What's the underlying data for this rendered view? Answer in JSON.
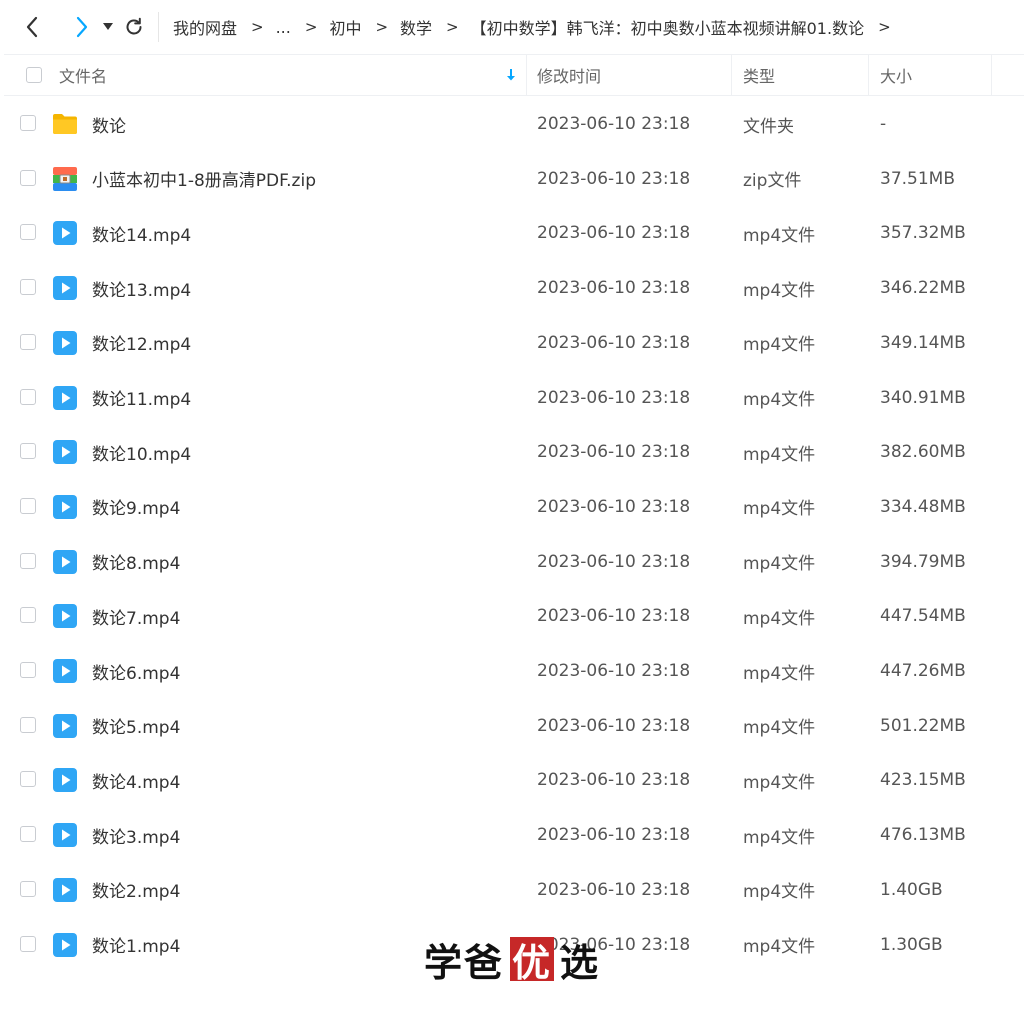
{
  "toolbar": {
    "back_icon": "chevron-left-icon",
    "forward_icon": "chevron-right-icon",
    "dropdown_icon": "caret-down-icon",
    "refresh_icon": "refresh-icon",
    "forward_color": "#06a7ff"
  },
  "breadcrumb": {
    "items": [
      "我的网盘",
      "...",
      "初中",
      "数学",
      "【初中数学】韩飞洋：初中奥数小蓝本视频讲解01.数论"
    ],
    "separator": ">"
  },
  "table": {
    "headers": {
      "name": "文件名",
      "modified": "修改时间",
      "type": "类型",
      "size": "大小"
    },
    "sort_icon": "sort-down-arrow-icon",
    "sort_color": "#06a7ff",
    "rows": [
      {
        "name": "数论",
        "modified": "2023-06-10 23:18",
        "type": "文件夹",
        "size": "-",
        "icon": "folder-icon"
      },
      {
        "name": "小蓝本初中1-8册高清PDF.zip",
        "modified": "2023-06-10 23:18",
        "type": "zip文件",
        "size": "37.51MB",
        "icon": "zip-icon"
      },
      {
        "name": "数论14.mp4",
        "modified": "2023-06-10 23:18",
        "type": "mp4文件",
        "size": "357.32MB",
        "icon": "video-icon"
      },
      {
        "name": "数论13.mp4",
        "modified": "2023-06-10 23:18",
        "type": "mp4文件",
        "size": "346.22MB",
        "icon": "video-icon"
      },
      {
        "name": "数论12.mp4",
        "modified": "2023-06-10 23:18",
        "type": "mp4文件",
        "size": "349.14MB",
        "icon": "video-icon"
      },
      {
        "name": "数论11.mp4",
        "modified": "2023-06-10 23:18",
        "type": "mp4文件",
        "size": "340.91MB",
        "icon": "video-icon"
      },
      {
        "name": "数论10.mp4",
        "modified": "2023-06-10 23:18",
        "type": "mp4文件",
        "size": "382.60MB",
        "icon": "video-icon"
      },
      {
        "name": "数论9.mp4",
        "modified": "2023-06-10 23:18",
        "type": "mp4文件",
        "size": "334.48MB",
        "icon": "video-icon"
      },
      {
        "name": "数论8.mp4",
        "modified": "2023-06-10 23:18",
        "type": "mp4文件",
        "size": "394.79MB",
        "icon": "video-icon"
      },
      {
        "name": "数论7.mp4",
        "modified": "2023-06-10 23:18",
        "type": "mp4文件",
        "size": "447.54MB",
        "icon": "video-icon"
      },
      {
        "name": "数论6.mp4",
        "modified": "2023-06-10 23:18",
        "type": "mp4文件",
        "size": "447.26MB",
        "icon": "video-icon"
      },
      {
        "name": "数论5.mp4",
        "modified": "2023-06-10 23:18",
        "type": "mp4文件",
        "size": "501.22MB",
        "icon": "video-icon"
      },
      {
        "name": "数论4.mp4",
        "modified": "2023-06-10 23:18",
        "type": "mp4文件",
        "size": "423.15MB",
        "icon": "video-icon"
      },
      {
        "name": "数论3.mp4",
        "modified": "2023-06-10 23:18",
        "type": "mp4文件",
        "size": "476.13MB",
        "icon": "video-icon"
      },
      {
        "name": "数论2.mp4",
        "modified": "2023-06-10 23:18",
        "type": "mp4文件",
        "size": "1.40GB",
        "icon": "video-icon"
      },
      {
        "name": "数论1.mp4",
        "modified": "2023-06-10 23:18",
        "type": "mp4文件",
        "size": "1.30GB",
        "icon": "video-icon"
      }
    ]
  },
  "watermark": {
    "part1": "学爸",
    "part2": "优",
    "part3": "选",
    "accent": "#c62828"
  }
}
